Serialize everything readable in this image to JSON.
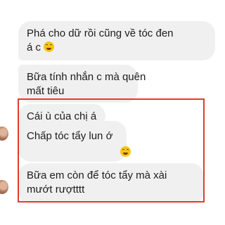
{
  "messages": [
    {
      "lines": [
        "Phá cho dữ rồi cũng về tóc đen",
        "á c"
      ],
      "emoji": "grinning-sweat-emoji"
    },
    {
      "lines": [
        "Bữa tính nhắn c mà quên",
        "mất tiêu"
      ]
    },
    {
      "lines": [
        "Cái ù của chị á"
      ]
    },
    {
      "lines": [
        "Chấp tóc tẩy lun ớ"
      ],
      "emoji": "grinning-sweat-emoji"
    },
    {
      "lines": [
        "Bữa em còn để tóc tẩy mà xài",
        "mướt rượtttt"
      ]
    }
  ],
  "colors": {
    "bubble": "#f0f0f0",
    "text": "#1c1c1c",
    "highlight_border": "#e53935"
  }
}
